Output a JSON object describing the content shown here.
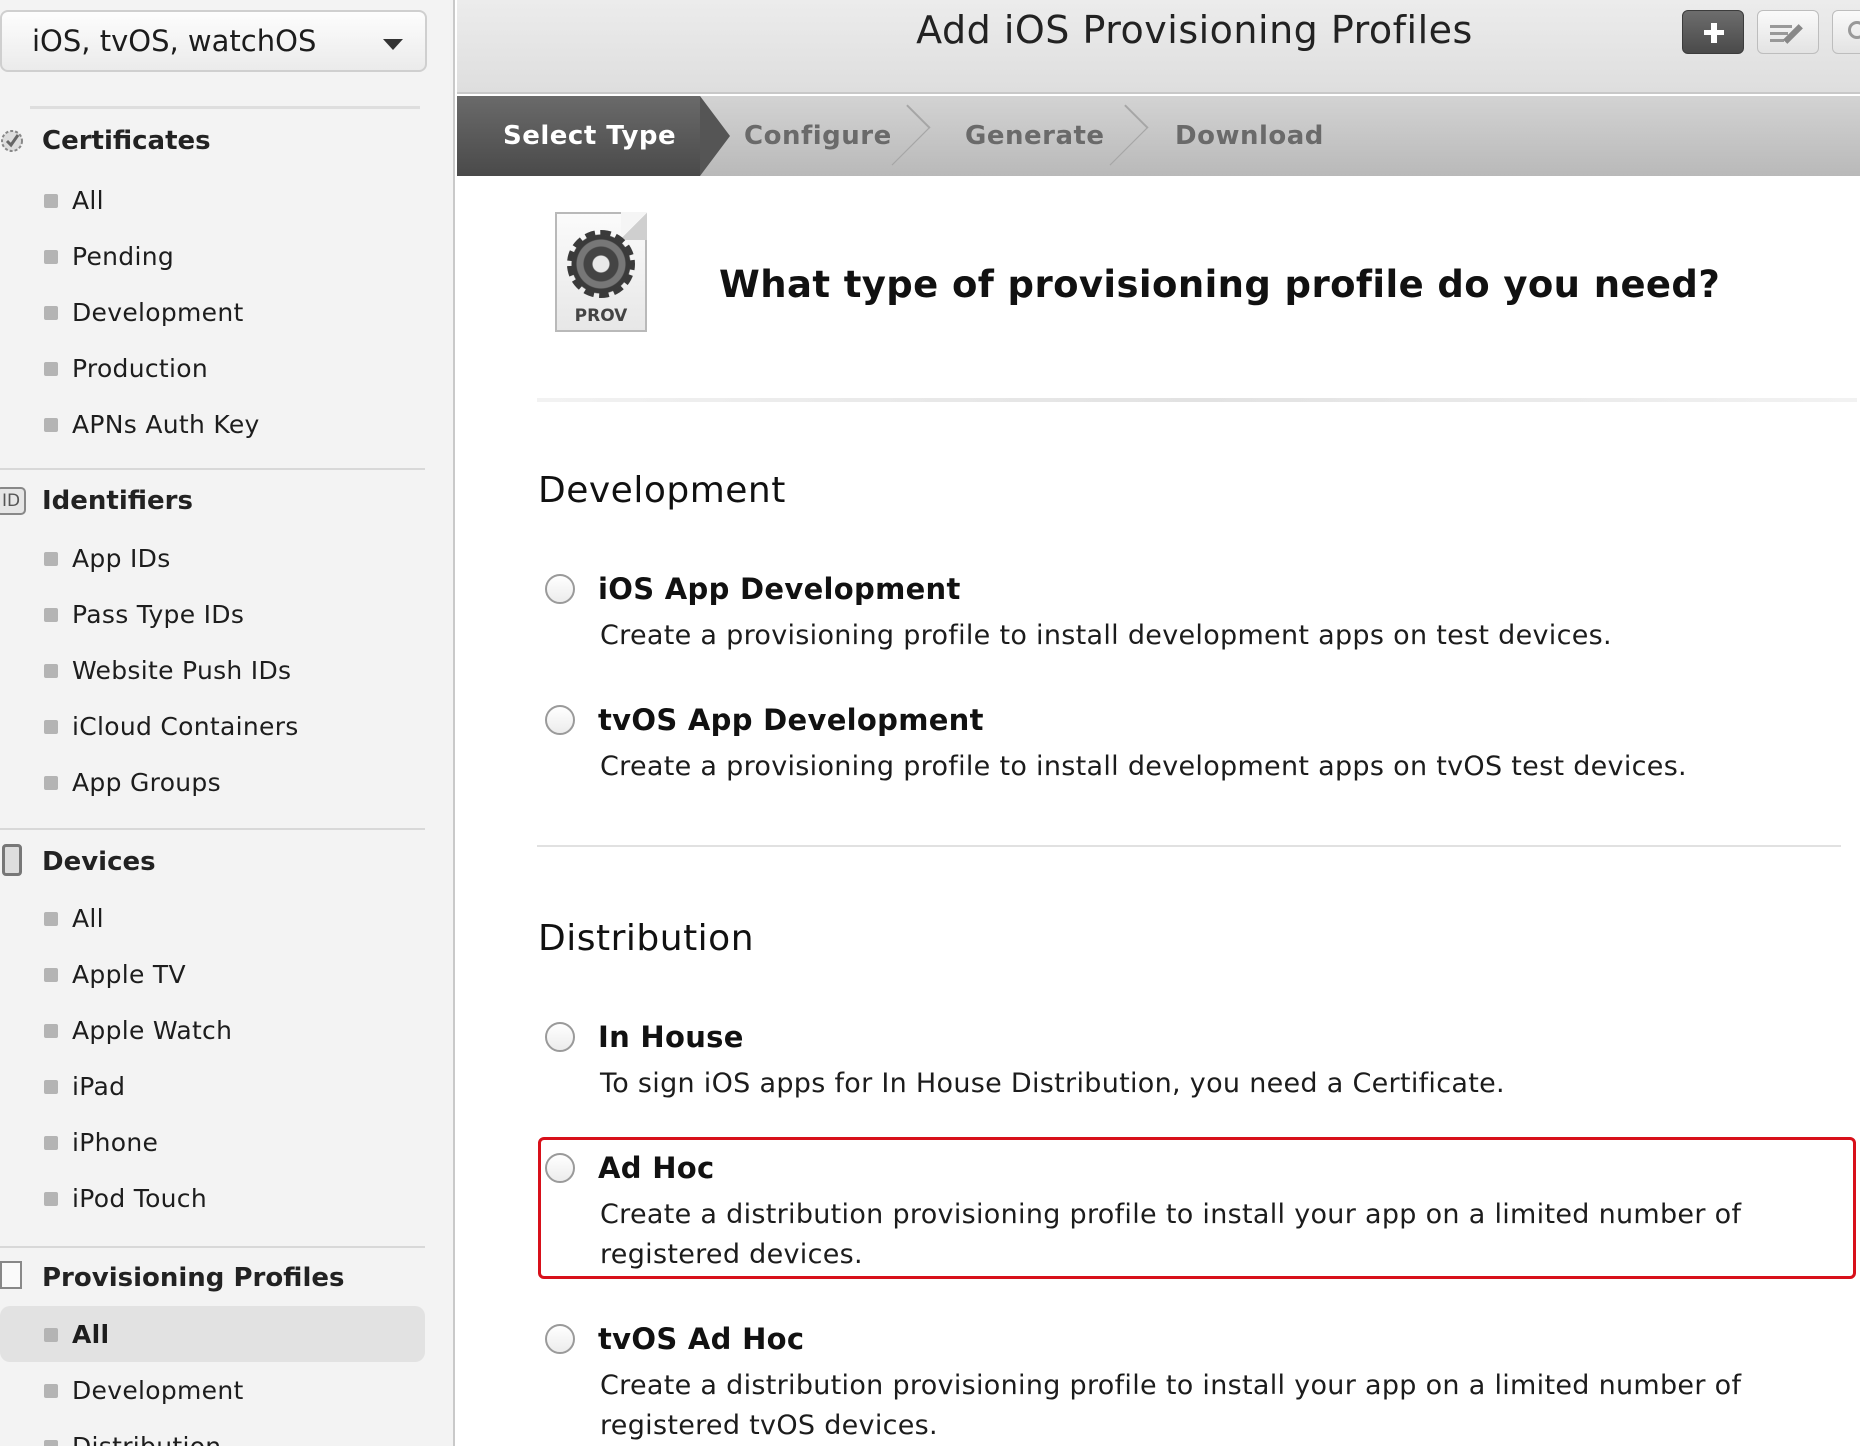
{
  "sidebar": {
    "platform_select": "iOS, tvOS, watchOS",
    "certificates": {
      "header": "Certificates",
      "items": [
        "All",
        "Pending",
        "Development",
        "Production",
        "APNs Auth Key"
      ]
    },
    "identifiers": {
      "header": "Identifiers",
      "badge": "ID",
      "items": [
        "App IDs",
        "Pass Type IDs",
        "Website Push IDs",
        "iCloud Containers",
        "App Groups"
      ]
    },
    "devices": {
      "header": "Devices",
      "items": [
        "All",
        "Apple TV",
        "Apple Watch",
        "iPad",
        "iPhone",
        "iPod Touch"
      ]
    },
    "provisioning_profiles": {
      "header": "Provisioning Profiles",
      "items": [
        "All",
        "Development",
        "Distribution"
      ],
      "active_item": "All"
    }
  },
  "header": {
    "title": "Add iOS Provisioning Profiles"
  },
  "steps": [
    "Select Type",
    "Configure",
    "Generate",
    "Download"
  ],
  "active_step": "Select Type",
  "main": {
    "icon_label": "PROV",
    "question": "What type of provisioning profile do you need?",
    "development": {
      "title": "Development",
      "options": [
        {
          "title": "iOS App Development",
          "description": "Create a provisioning profile to install development apps on test devices."
        },
        {
          "title": "tvOS App Development",
          "description": "Create a provisioning profile to install development apps on tvOS test devices."
        }
      ]
    },
    "distribution": {
      "title": "Distribution",
      "options": [
        {
          "title": "In House",
          "description": "To sign iOS apps for In House Distribution, you need a Certificate."
        },
        {
          "title": "Ad Hoc",
          "description": "Create a distribution provisioning profile to install your app on a limited number of registered devices."
        },
        {
          "title": "tvOS Ad Hoc",
          "description": "Create a distribution provisioning profile to install your app on a limited number of registered tvOS devices."
        }
      ]
    }
  },
  "colors": {
    "highlight": "#d8101a",
    "active_step_bg": "#555555"
  }
}
